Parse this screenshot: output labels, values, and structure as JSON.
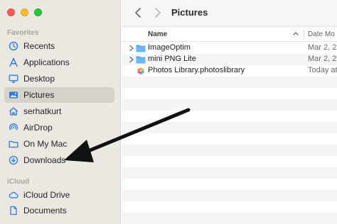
{
  "window": {
    "title": "Pictures"
  },
  "sidebar": {
    "sections": [
      {
        "label": "Favorites"
      },
      {
        "label": "iCloud"
      }
    ],
    "favorites": [
      {
        "label": "Recents",
        "icon": "clock-icon"
      },
      {
        "label": "Applications",
        "icon": "applications-icon"
      },
      {
        "label": "Desktop",
        "icon": "desktop-icon"
      },
      {
        "label": "Pictures",
        "icon": "pictures-icon",
        "selected": true
      },
      {
        "label": "serhatkurt",
        "icon": "home-icon"
      },
      {
        "label": "AirDrop",
        "icon": "airdrop-icon"
      },
      {
        "label": "On My Mac",
        "icon": "folder-icon"
      },
      {
        "label": "Downloads",
        "icon": "downloads-icon"
      }
    ],
    "icloud": [
      {
        "label": "iCloud Drive",
        "icon": "icloud-icon"
      },
      {
        "label": "Documents",
        "icon": "document-icon"
      }
    ]
  },
  "columns": {
    "name": "Name",
    "date": "Date Mo"
  },
  "files": [
    {
      "name": "ImageOptim",
      "date": "Mar 2, 2",
      "type": "folder",
      "expandable": true
    },
    {
      "name": "mini PNG Lite",
      "date": "Mar 2, 2",
      "type": "folder",
      "expandable": true
    },
    {
      "name": "Photos Library.photoslibrary",
      "date": "Today at",
      "type": "photos-library",
      "expandable": false
    }
  ],
  "colors": {
    "sidebar_bg": "#ebe7e1",
    "selected_bg": "#d6d2cc",
    "icon_accent": "#2f7be0",
    "folder_blue": "#4aa3ec",
    "arrow": "#111111"
  }
}
